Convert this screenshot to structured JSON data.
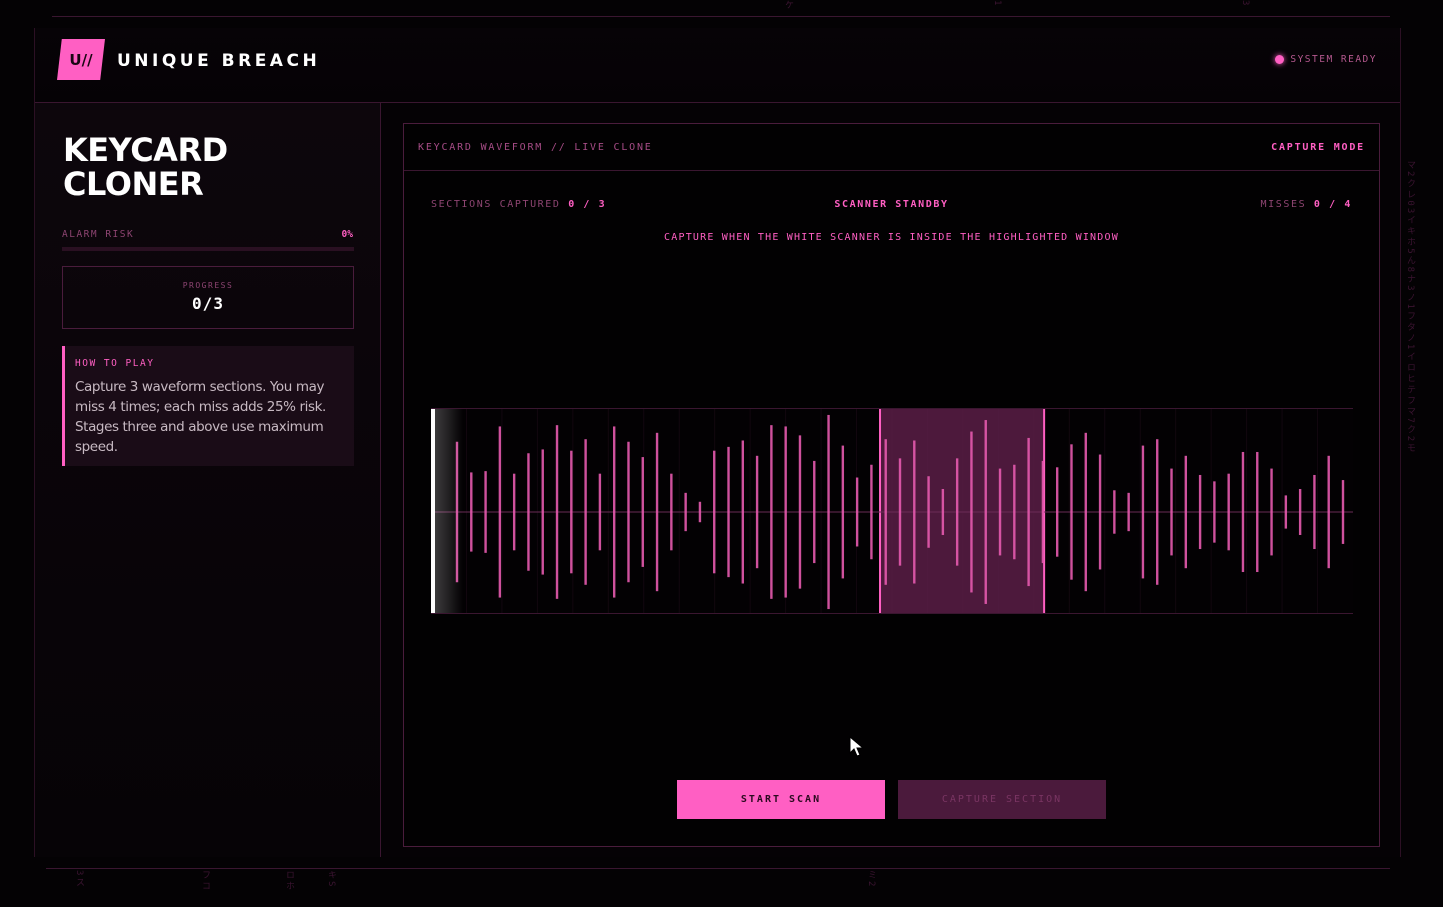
{
  "header": {
    "logo_text": "U//",
    "brand": "UNIQUE BREACH",
    "status": "SYSTEM READY"
  },
  "sidebar": {
    "title": "KEYCARD CLONER",
    "alarm_label": "ALARM RISK",
    "alarm_value": "0%",
    "alarm_fraction": 0,
    "progress_label": "PROGRESS",
    "progress_value": "0/3",
    "howto_title": "HOW TO PLAY",
    "howto_text": "Capture 3 waveform sections. You may miss 4 times; each miss adds 25% risk. Stages three and above use maximum speed."
  },
  "panel": {
    "title": "KEYCARD WAVEFORM // LIVE CLONE",
    "mode": "CAPTURE MODE",
    "sections_label": "SECTIONS CAPTURED",
    "sections_value": "0 / 3",
    "scanner_status": "SCANNER STANDBY",
    "misses_label": "MISSES",
    "misses_value": "0 / 4",
    "hint": "CAPTURE WHEN THE WHITE SCANNER IS INSIDE THE HIGHLIGHTED WINDOW"
  },
  "buttons": {
    "start": "START SCAN",
    "capture": "CAPTURE SECTION"
  },
  "colors": {
    "accent": "#ff5fc3",
    "background": "#040204",
    "panel_border": "#4a1c3c",
    "disabled_button": "#4b1a3c"
  },
  "waveform": {
    "bar_heights": [
      0.62,
      0.66,
      0.68,
      0.68,
      0.64,
      0.68,
      0.68,
      0.75,
      0.67,
      0.65,
      0.68,
      0.64,
      0.75,
      0.68,
      0.68,
      0.65,
      0.72,
      0.68,
      0.72,
      0.72,
      0.72,
      0.76,
      0.64,
      0.74,
      0.68,
      0.62,
      0.72,
      0.64,
      0.6,
      0.68,
      0.66,
      0.67,
      0.6,
      0.68,
      0.72,
      0.73,
      0.62,
      0.68,
      0.62,
      0.62,
      0.64,
      0.6,
      0.68,
      0.7,
      0.68,
      0.6,
      0.64,
      0.66,
      0.5,
      0.58,
      0.7,
      0.66,
      0.56,
      0.58,
      0.6,
      0.62,
      0.5,
      0.5,
      0.56,
      0.5,
      0.52,
      0.54,
      0.52
    ],
    "bar_amplitudes": [
      0.55,
      0.31,
      0.32,
      0.67,
      0.3,
      0.46,
      0.49,
      0.68,
      0.48,
      0.57,
      0.3,
      0.67,
      0.55,
      0.43,
      0.62,
      0.3,
      0.15,
      0.08,
      0.48,
      0.51,
      0.56,
      0.44,
      0.68,
      0.67,
      0.6,
      0.4,
      0.76,
      0.52,
      0.27,
      0.37,
      0.57,
      0.42,
      0.56,
      0.28,
      0.18,
      0.42,
      0.63,
      0.72,
      0.34,
      0.37,
      0.58,
      0.4,
      0.35,
      0.53,
      0.62,
      0.45,
      0.17,
      0.15,
      0.52,
      0.57,
      0.34,
      0.44,
      0.29,
      0.24,
      0.3,
      0.47,
      0.47,
      0.34,
      0.13,
      0.18,
      0.29,
      0.44,
      0.25
    ],
    "capture_window_start": 0.487,
    "capture_window_end": 0.665,
    "scanner_position": 0.0
  }
}
